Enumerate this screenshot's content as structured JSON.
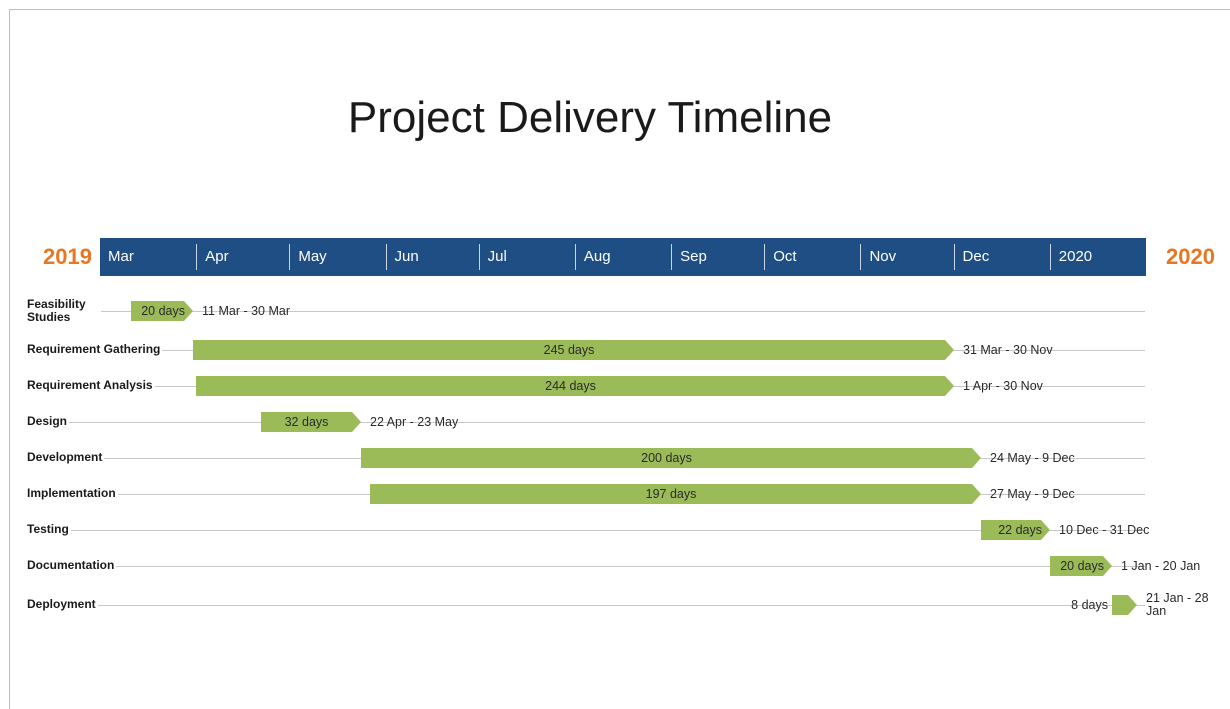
{
  "title": "Project Delivery Timeline",
  "year_start": "2019",
  "year_end": "2020",
  "colors": {
    "month_band": "#1f4e84",
    "bar": "#9bbb59",
    "year": "#e87722"
  },
  "months": [
    "Mar",
    "Apr",
    "May",
    "Jun",
    "Jul",
    "Aug",
    "Sep",
    "Oct",
    "Nov",
    "Dec",
    "2020"
  ],
  "chart_data": {
    "type": "gantt",
    "title": "Project Delivery Timeline",
    "x_axis": {
      "ticks": [
        "Mar",
        "Apr",
        "May",
        "Jun",
        "Jul",
        "Aug",
        "Sep",
        "Oct",
        "Nov",
        "Dec",
        "2020"
      ],
      "range": [
        "2019-03-01",
        "2020-01-31"
      ]
    },
    "tasks": [
      {
        "name": "Feasibility Studies",
        "start": "2019-03-11",
        "end": "2019-03-30",
        "duration": "20 days",
        "dates": "11 Mar - 30 Mar"
      },
      {
        "name": "Requirement Gathering",
        "start": "2019-03-31",
        "end": "2019-11-30",
        "duration": "245 days",
        "dates": "31 Mar - 30 Nov"
      },
      {
        "name": "Requirement Analysis",
        "start": "2019-04-01",
        "end": "2019-11-30",
        "duration": "244 days",
        "dates": "1 Apr - 30 Nov"
      },
      {
        "name": "Design",
        "start": "2019-04-22",
        "end": "2019-05-23",
        "duration": "32 days",
        "dates": "22 Apr - 23 May"
      },
      {
        "name": "Development",
        "start": "2019-05-24",
        "end": "2019-12-09",
        "duration": "200 days",
        "dates": "24 May - 9 Dec"
      },
      {
        "name": "Implementation",
        "start": "2019-05-27",
        "end": "2019-12-09",
        "duration": "197 days",
        "dates": "27 May - 9 Dec"
      },
      {
        "name": "Testing",
        "start": "2019-12-10",
        "end": "2019-12-31",
        "duration": "22 days",
        "dates": "10 Dec - 31 Dec"
      },
      {
        "name": "Documentation",
        "start": "2020-01-01",
        "end": "2020-01-20",
        "duration": "20 days",
        "dates": "1 Jan - 20 Jan"
      },
      {
        "name": "Deployment",
        "start": "2020-01-21",
        "end": "2020-01-28",
        "duration": "8 days",
        "dates": "21 Jan - 28 Jan"
      }
    ]
  }
}
